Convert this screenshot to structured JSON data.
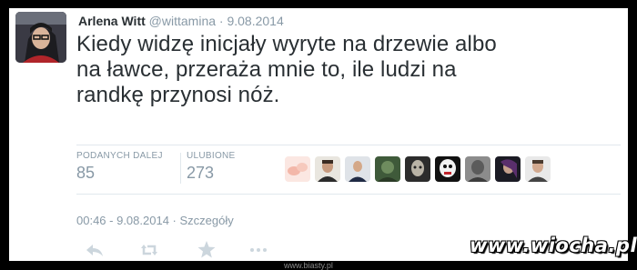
{
  "tweet": {
    "author_name": "Arlena Witt",
    "author_handle": "@wittamina",
    "separator": "·",
    "date_short": "9.08.2014",
    "text": "Kiedy widzę inicjały wyryte na drzewie albo\nna ławce, przeraża mnie to, ile ludzi na\nrandkę przynosi nóż."
  },
  "stats": {
    "retweets_label": "PODANYCH DALEJ",
    "retweets_value": "85",
    "favorites_label": "ULUBIONE",
    "favorites_value": "273"
  },
  "meta": {
    "time": "00:46 - 9.08.2014",
    "separator": "·",
    "details_link": "Szczegóły"
  },
  "actions": {
    "reply_icon": "reply-icon",
    "retweet_icon": "retweet-icon",
    "favorite_icon": "star-icon",
    "more_icon": "more-icon"
  },
  "watermark": {
    "text": "www.wiocha.pl"
  },
  "footer_watermark": {
    "text": "www.biasty.pl"
  },
  "colors": {
    "text_primary": "#292f33",
    "text_secondary": "#8899a6",
    "divider": "#e1e8ed",
    "icon_muted": "#ccd6dd",
    "background": "#000000"
  }
}
